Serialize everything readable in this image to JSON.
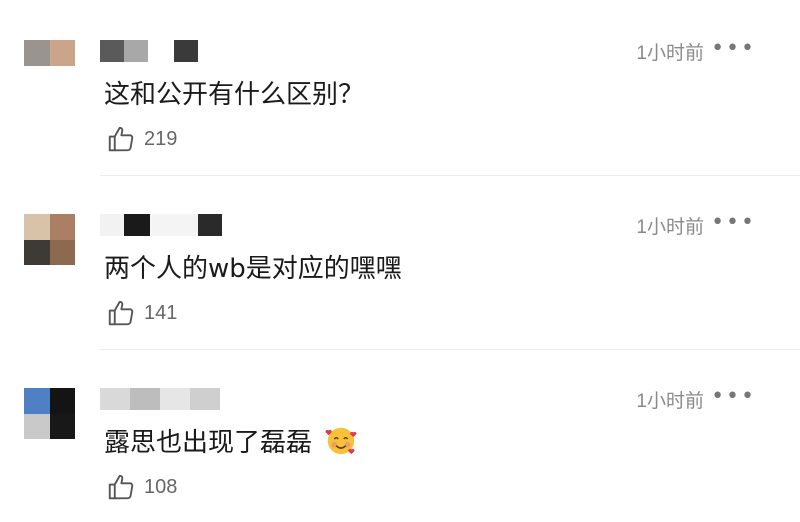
{
  "colors": {
    "text": "#1a1a1a",
    "meta": "#8a8a8a",
    "divider": "#ececec"
  },
  "comments": [
    {
      "time": "1小时前",
      "more": "•••",
      "text": "这和公开有什么区别？",
      "likes": "219",
      "avatar_colors": [
        "#9a9490",
        "#caa58a"
      ],
      "username_blocks": [
        "#5a5a5a",
        "#a8a8a8",
        "#ffffff",
        "#3a3a3a"
      ]
    },
    {
      "time": "1小时前",
      "more": "•••",
      "text": "两个人的wb是对应的嘿嘿",
      "likes": "141",
      "avatar_colors": [
        "#d8c3a8",
        "#ab7f63",
        "#3e3a36",
        "#8c6a50"
      ],
      "username_blocks": [
        "#f2f2f2",
        "#1a1a1a",
        "#f4f4f4",
        "#2a2a2a"
      ]
    },
    {
      "time": "1小时前",
      "more": "•••",
      "text": "露思也出现了磊磊",
      "likes": "108",
      "emoji": "smiling-face-with-hearts",
      "avatar_colors": [
        "#4f7fc4",
        "#141414",
        "#c9c9c9",
        "#181818"
      ],
      "username_blocks": [
        "#d9d9d9",
        "#bdbdbd",
        "#e6e6e6",
        "#cfcfcf"
      ]
    }
  ]
}
